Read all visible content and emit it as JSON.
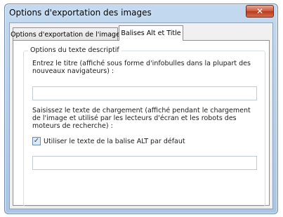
{
  "window": {
    "title": "Options d'exportation des images",
    "close_glyph": "✕"
  },
  "tabs": [
    {
      "label": "Options d'exportation de l'image",
      "selected": false
    },
    {
      "label": "Balises Alt et Title",
      "selected": true
    }
  ],
  "group": {
    "legend": "Options du texte descriptif",
    "title_label": "Entrez le titre (affiché sous forme d'infobulles dans la plupart des nouveaux navigateurs) :",
    "title_value": "",
    "loading_label": "Saisissez le texte de chargement (affiché pendant le chargement de l'image et utilisé par les lecteurs d'écran et les robots des moteurs de recherche) :",
    "alt_checkbox": {
      "label": "Utiliser le texte de la balise ALT par défaut",
      "checked": true,
      "glyph": "✓"
    },
    "loading_value": ""
  }
}
